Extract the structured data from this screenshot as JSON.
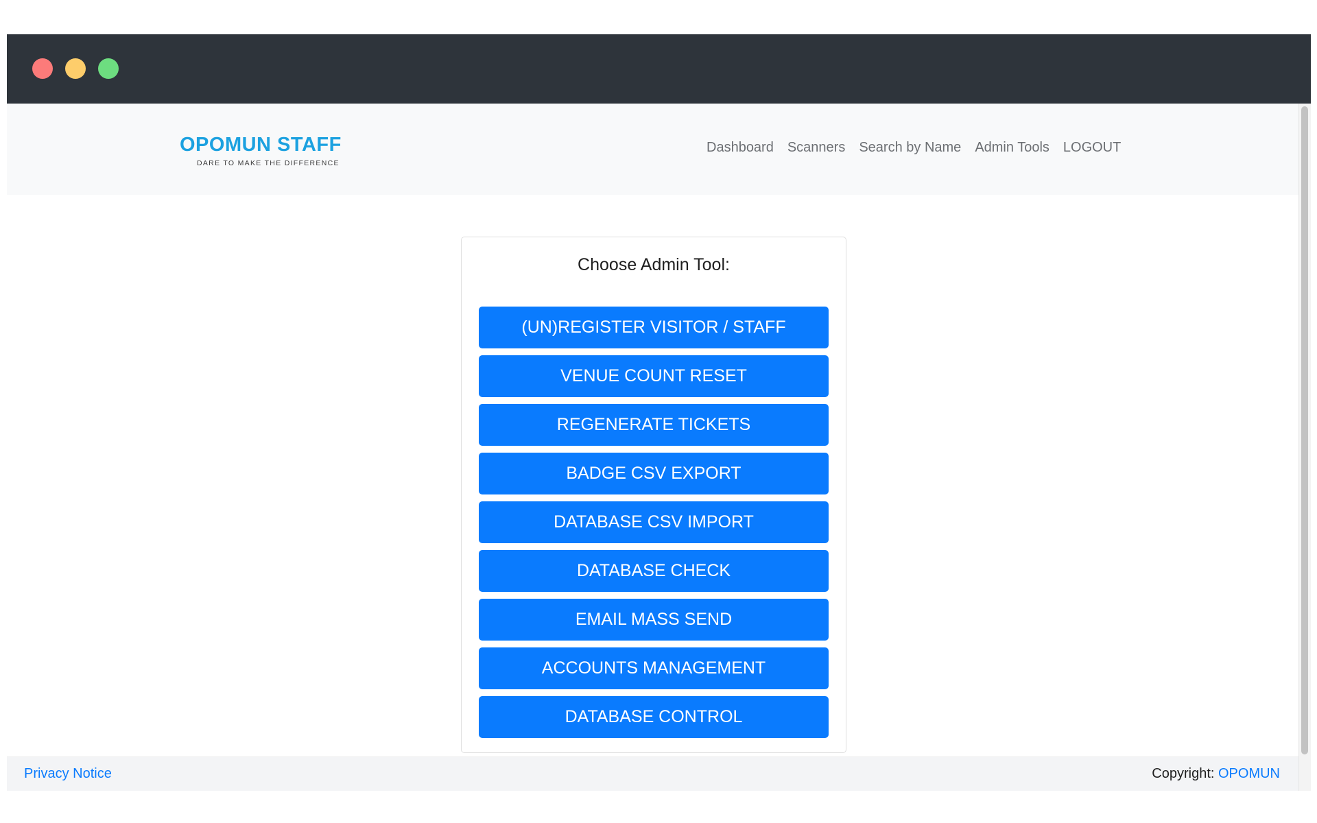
{
  "window": {
    "controls": [
      "close",
      "minimize",
      "maximize"
    ],
    "colors": {
      "close": "#fc7b7a",
      "minimize": "#fdcd6b",
      "maximize": "#6ddd80",
      "titlebar": "#2e343b"
    }
  },
  "brand": {
    "title": "OPOMUN STAFF",
    "tagline": "DARE TO MAKE THE DIFFERENCE",
    "color": "#1ca1e0"
  },
  "nav": {
    "items": [
      {
        "label": "Dashboard"
      },
      {
        "label": "Scanners"
      },
      {
        "label": "Search by Name"
      },
      {
        "label": "Admin Tools"
      },
      {
        "label": "LOGOUT"
      }
    ]
  },
  "admin": {
    "title": "Choose Admin Tool:",
    "buttons": [
      {
        "label": "(UN)REGISTER VISITOR / STAFF"
      },
      {
        "label": "VENUE COUNT RESET"
      },
      {
        "label": "REGENERATE TICKETS"
      },
      {
        "label": "BADGE CSV EXPORT"
      },
      {
        "label": "DATABASE CSV IMPORT"
      },
      {
        "label": "DATABASE CHECK"
      },
      {
        "label": "EMAIL MASS SEND"
      },
      {
        "label": "ACCOUNTS MANAGEMENT"
      },
      {
        "label": "DATABASE CONTROL"
      }
    ],
    "button_color": "#0a7bfe"
  },
  "footer": {
    "privacy_label": "Privacy Notice",
    "copyright_prefix": "Copyright:",
    "copyright_link": "OPOMUN"
  }
}
